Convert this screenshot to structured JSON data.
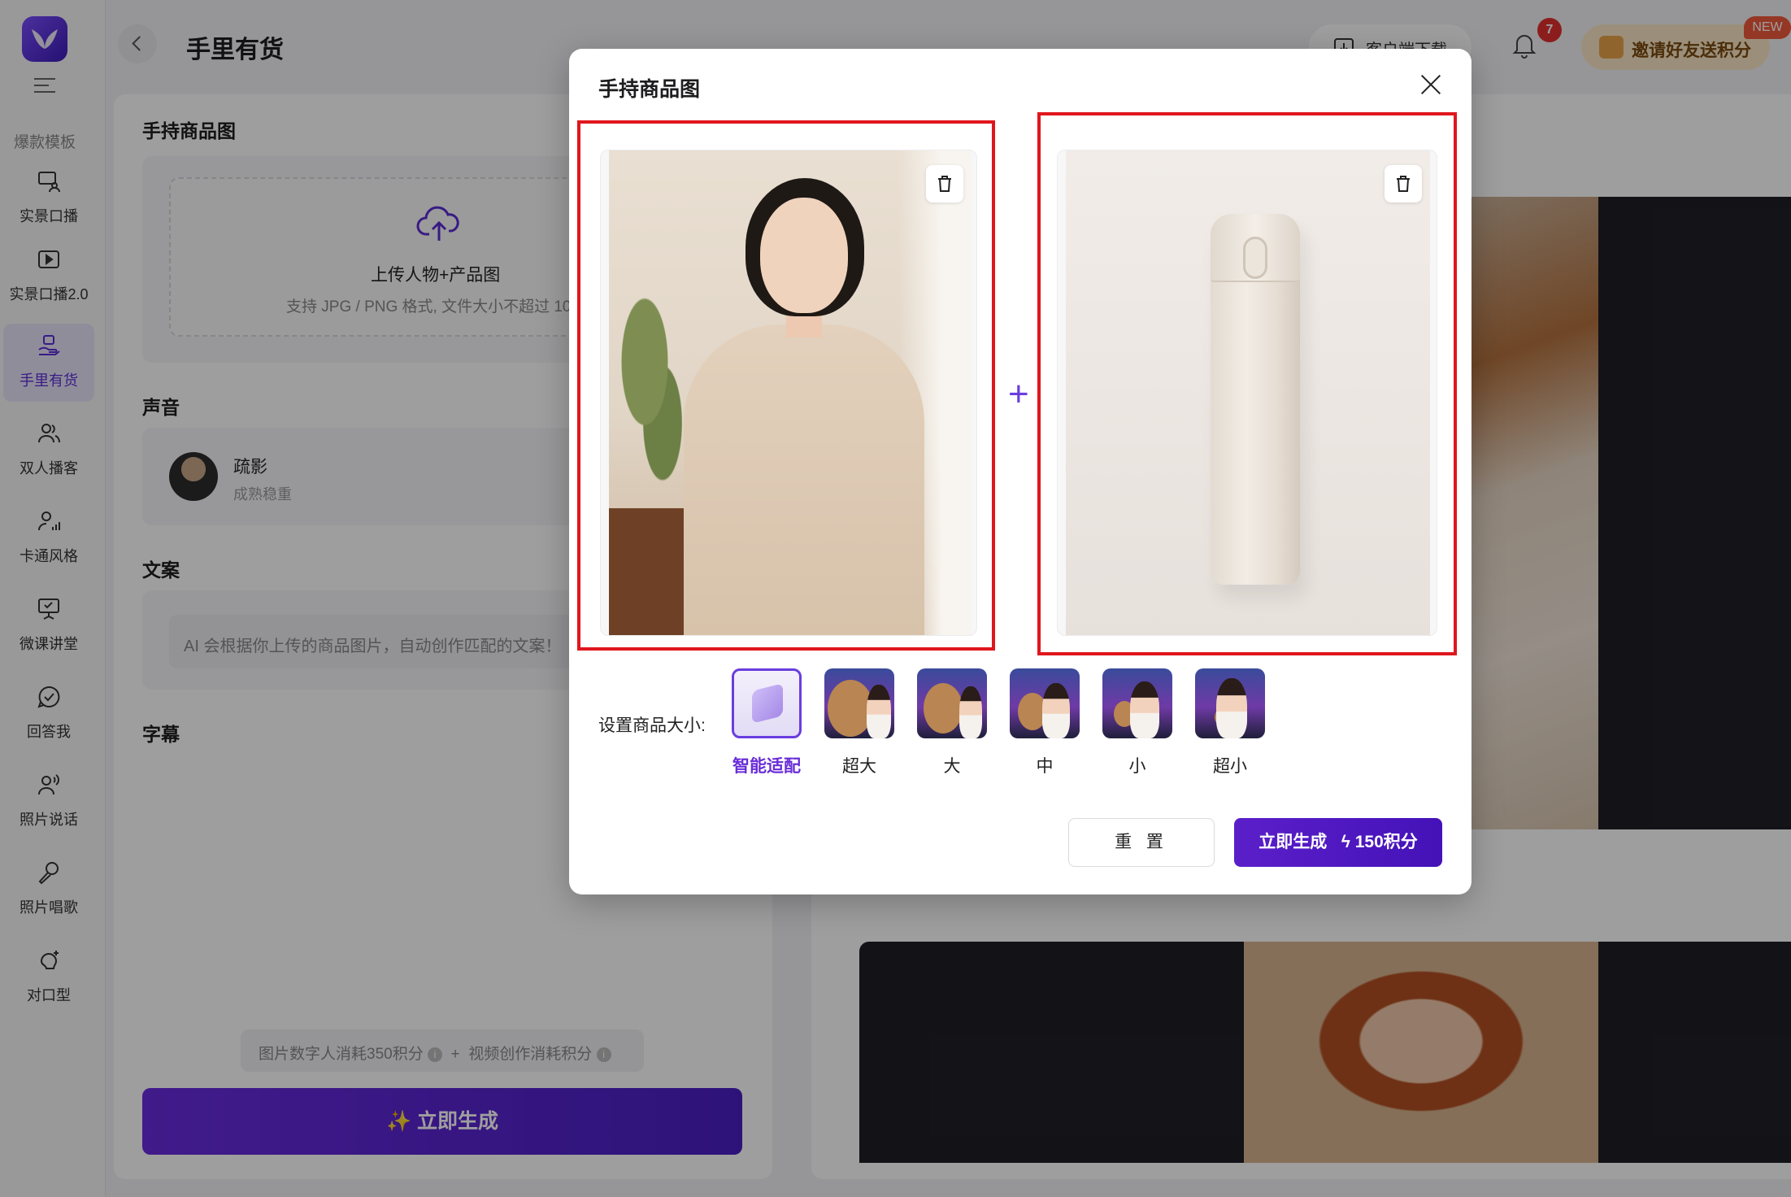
{
  "header": {
    "title": "手里有货",
    "client_download": "客户端下载",
    "notification_count": "7",
    "invite_label": "邀请好友送积分",
    "new_tag": "NEW"
  },
  "sidebar": {
    "section_label": "爆款模板",
    "items": [
      {
        "label": "实景口播",
        "icon": "presenter-icon"
      },
      {
        "label": "实景口播2.0",
        "icon": "play-screen-icon"
      },
      {
        "label": "手里有货",
        "icon": "hand-product-icon",
        "active": true
      },
      {
        "label": "双人播客",
        "icon": "two-users-icon"
      },
      {
        "label": "卡通风格",
        "icon": "cartoon-user-icon"
      },
      {
        "label": "微课讲堂",
        "icon": "lecture-board-icon"
      },
      {
        "label": "回答我",
        "icon": "check-bubble-icon"
      },
      {
        "label": "照片说话",
        "icon": "talking-user-icon"
      },
      {
        "label": "照片唱歌",
        "icon": "microphone-icon"
      },
      {
        "label": "对口型",
        "icon": "lip-sync-icon"
      }
    ]
  },
  "main": {
    "product_section": "手持商品图",
    "upload_title": "上传人物+产品图",
    "upload_hint": "支持 JPG / PNG 格式, 文件大小不超过 10",
    "voice_section": "声音",
    "voice_name": "疏影",
    "voice_desc": "成熟稳重",
    "copy_section": "文案",
    "copy_placeholder": "AI 会根据你上传的商品图片，自动创作匹配的文案！",
    "subtitle_section": "字幕",
    "cost_part1": "图片数字人消耗350积分",
    "cost_plus": "+",
    "cost_part2": "视频创作消耗积分",
    "generate_label": "立即生成"
  },
  "modal": {
    "title": "手持商品图",
    "plus_sign": "+",
    "size_label": "设置商品大小:",
    "size_options": [
      "智能适配",
      "超大",
      "大",
      "中",
      "小",
      "超小"
    ],
    "selected_size": "智能适配",
    "reset_label": "重 置",
    "generate_label": "立即生成",
    "generate_cost": "150积分"
  },
  "colors": {
    "accent": "#5b1fc9",
    "highlight_box": "#e0161d",
    "notification": "#e0312f"
  }
}
